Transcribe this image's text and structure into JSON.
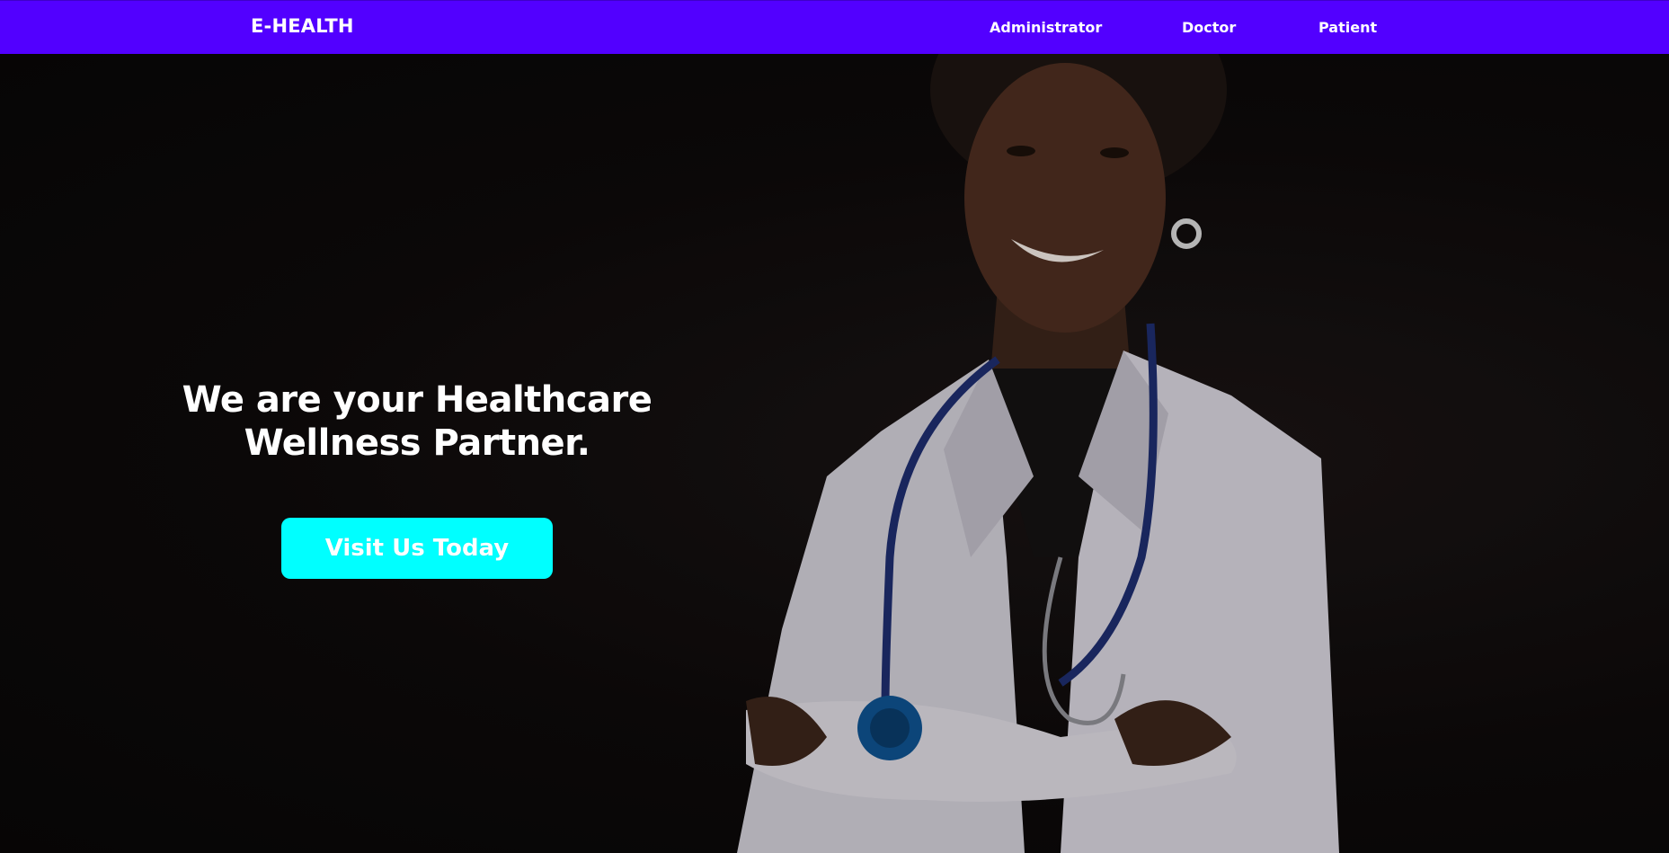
{
  "navbar": {
    "brand": "E-HEALTH",
    "links": [
      {
        "label": "Administrator"
      },
      {
        "label": "Doctor"
      },
      {
        "label": "Patient"
      }
    ],
    "background_color": "#5200ff"
  },
  "hero": {
    "headline_line1": "We are your Healthcare",
    "headline_line2": "Wellness Partner.",
    "cta_label": "Visit Us Today",
    "cta_color": "#00ffff",
    "image_subject": "smiling-doctor-with-stethoscope"
  }
}
